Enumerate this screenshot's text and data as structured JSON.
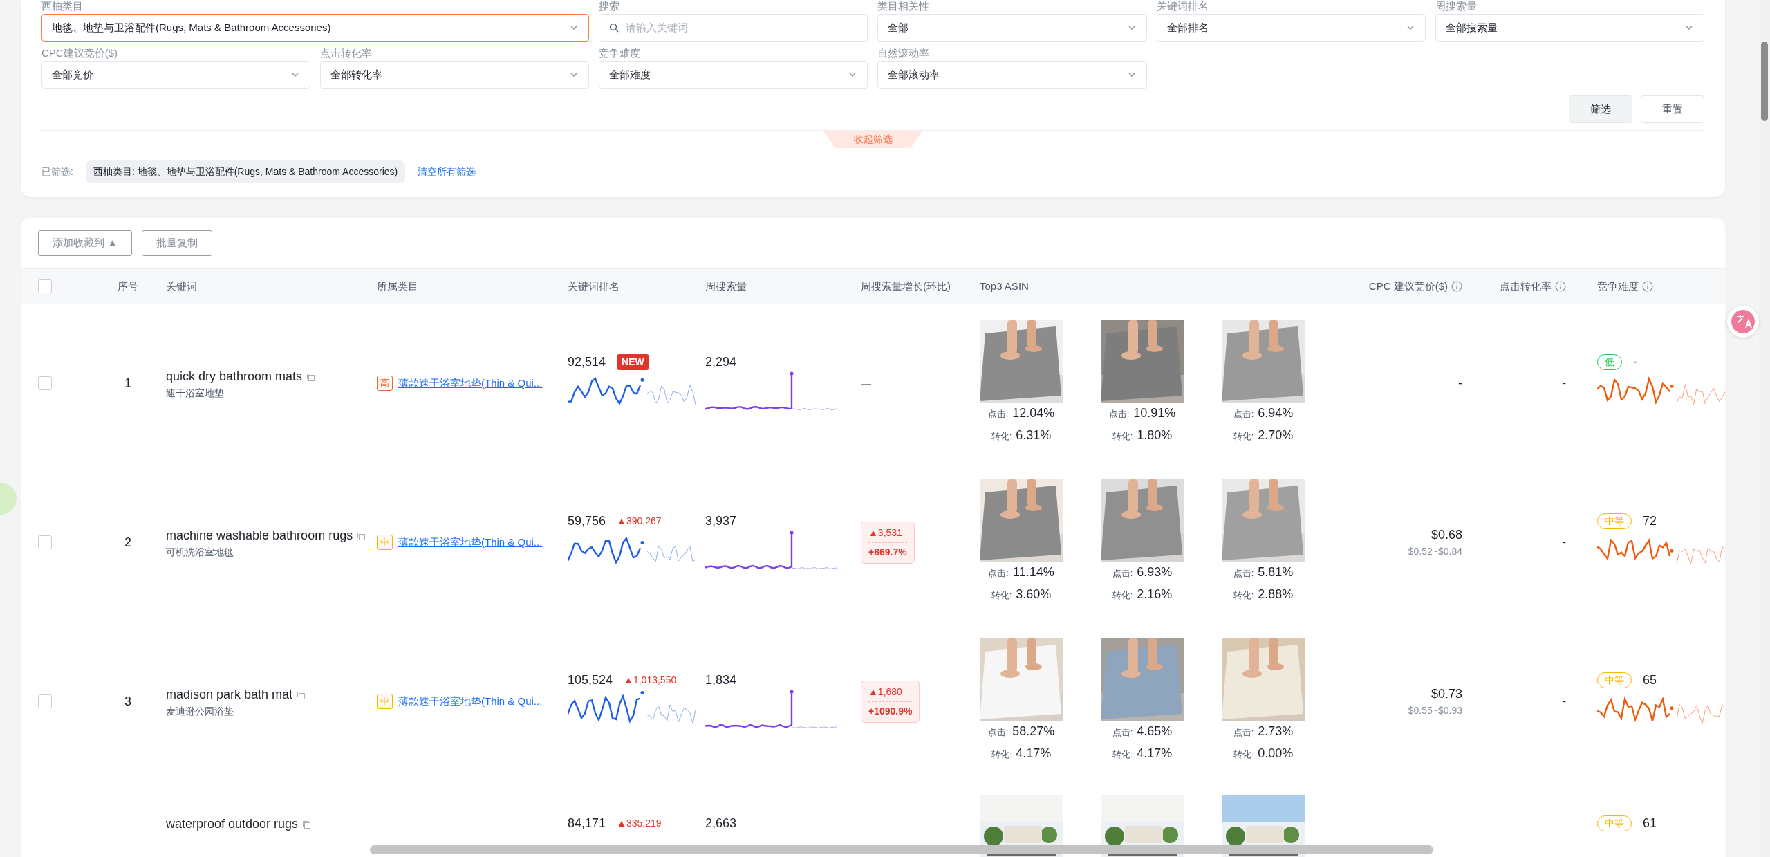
{
  "filters": [
    {
      "label": "西柚类目",
      "kind": "select",
      "value": "地毯、地垫与卫浴配件(Rugs, Mats & Bathroom Accessories)",
      "active": true
    },
    {
      "label": "搜索",
      "kind": "search",
      "placeholder": "请输入关键词",
      "active": false
    },
    {
      "label": "类目相关性",
      "kind": "select",
      "value": "全部",
      "active": false
    },
    {
      "label": "关键词排名",
      "kind": "select",
      "value": "全部排名",
      "active": false
    },
    {
      "label": "周搜索量",
      "kind": "select",
      "value": "全部搜索量",
      "active": false
    },
    {
      "label": "CPC建议竞价($)",
      "kind": "select",
      "value": "全部竞价",
      "active": false
    },
    {
      "label": "点击转化率",
      "kind": "select",
      "value": "全部转化率",
      "active": false
    },
    {
      "label": "竞争难度",
      "kind": "select",
      "value": "全部难度",
      "active": false
    },
    {
      "label": "自然滚动率",
      "kind": "select",
      "value": "全部滚动率",
      "active": false
    }
  ],
  "filter_buttons": [
    {
      "label": "筛选",
      "kind": "filled"
    },
    {
      "label": "重置",
      "kind": "outline"
    }
  ],
  "collapse_tab": "收起筛选",
  "applied": {
    "label": "已筛选:",
    "chips": [
      "西柚类目: 地毯、地垫与卫浴配件(Rugs, Mats & Bathroom Accessories)"
    ],
    "clear_link": "清空所有筛选"
  },
  "toolbar": [
    "添加收藏到 ▲",
    "批量复制"
  ],
  "table": {
    "select_all": {
      "checked": false
    },
    "columns": [
      {
        "label": "序号",
        "info": false
      },
      {
        "label": "关键词",
        "info": false
      },
      {
        "label": "所属类目",
        "info": false
      },
      {
        "label": "关键词排名",
        "info": false
      },
      {
        "label": "周搜索量",
        "info": false
      },
      {
        "label": "周搜索量增长(环比)",
        "info": false
      },
      {
        "label": "Top3 ASIN",
        "info": false
      },
      {
        "label": "CPC 建议竞价($)",
        "info": true
      },
      {
        "label": "点击转化率",
        "info": true
      },
      {
        "label": "竞争难度",
        "info": true
      }
    ],
    "rows": [
      {
        "checked": false,
        "index": "1",
        "keyword": "quick dry bathroom mats",
        "translation": "速干浴室地垫",
        "category": {
          "level": "高",
          "color": "#f5622d",
          "text": "薄款速干浴室地垫(Thin & Qui..."
        },
        "rank": "92,514",
        "rank_note": {
          "kind": "badge",
          "text": "NEW"
        },
        "volume": "2,294",
        "growth": {
          "kind": "none",
          "text": "—"
        },
        "asins": [
          {
            "kind": "picture",
            "click_label": "点击:",
            "click": "12.04%",
            "conv_label": "转化:",
            "conv": "6.31%"
          },
          {
            "kind": "picture",
            "click_label": "点击:",
            "click": "10.91%",
            "conv_label": "转化:",
            "conv": "1.80%"
          },
          {
            "kind": "picture",
            "click_label": "点击:",
            "click": "6.94%",
            "conv_label": "转化:",
            "conv": "2.70%"
          }
        ],
        "cpc": {
          "price": "-"
        },
        "conversion": "-",
        "competition": {
          "level": "低",
          "color": "#2fc25b",
          "score": "-"
        },
        "trend_charts": true
      },
      {
        "checked": false,
        "index": "2",
        "keyword": "machine washable bathroom rugs",
        "translation": "可机洗浴室地毯",
        "category": {
          "level": "中",
          "color": "#f7b500",
          "text": "薄款速干浴室地垫(Thin & Qui..."
        },
        "rank": "59,756",
        "rank_note": {
          "kind": "change",
          "text": "▲390,267"
        },
        "volume": "3,937",
        "growth": {
          "kind": "box",
          "abs": "▲3,531",
          "pct": "+869.7%"
        },
        "asins": [
          {
            "kind": "picture",
            "click_label": "点击:",
            "click": "11.14%",
            "conv_label": "转化:",
            "conv": "3.60%"
          },
          {
            "kind": "picture",
            "click_label": "点击:",
            "click": "6.93%",
            "conv_label": "转化:",
            "conv": "2.16%"
          },
          {
            "kind": "picture",
            "click_label": "点击:",
            "click": "5.81%",
            "conv_label": "转化:",
            "conv": "2.88%"
          }
        ],
        "cpc": {
          "price": "$0.68",
          "range": "$0.52~$0.84"
        },
        "conversion": "-",
        "competition": {
          "level": "中等",
          "color": "#f7b500",
          "score": "72"
        },
        "trend_charts": true
      },
      {
        "checked": false,
        "index": "3",
        "keyword": "madison park bath mat",
        "translation": "麦迪逊公园浴垫",
        "category": {
          "level": "中",
          "color": "#f7b500",
          "text": "薄款速干浴室地垫(Thin & Qui..."
        },
        "rank": "105,524",
        "rank_note": {
          "kind": "change",
          "text": "▲1,013,550"
        },
        "volume": "1,834",
        "growth": {
          "kind": "box",
          "abs": "▲1,680",
          "pct": "+1090.9%"
        },
        "asins": [
          {
            "kind": "picture",
            "click_label": "点击:",
            "click": "58.27%",
            "conv_label": "转化:",
            "conv": "4.17%"
          },
          {
            "kind": "picture",
            "click_label": "点击:",
            "click": "4.65%",
            "conv_label": "转化:",
            "conv": "4.17%"
          },
          {
            "kind": "picture",
            "click_label": "点击:",
            "click": "2.73%",
            "conv_label": "转化:",
            "conv": "0.00%"
          }
        ],
        "cpc": {
          "price": "$0.73",
          "range": "$0.55~$0.93"
        },
        "conversion": "-",
        "competition": {
          "level": "中等",
          "color": "#f7b500",
          "score": "65"
        },
        "trend_charts": true
      },
      {
        "keyword": "waterproof outdoor rugs",
        "rank": "84,171",
        "rank_note": {
          "kind": "change",
          "text": "▲335,219"
        },
        "volume": "2,663",
        "competition": {
          "level": "中等",
          "color": "#f7b500",
          "score": "61"
        },
        "trend_charts": false
      }
    ]
  }
}
